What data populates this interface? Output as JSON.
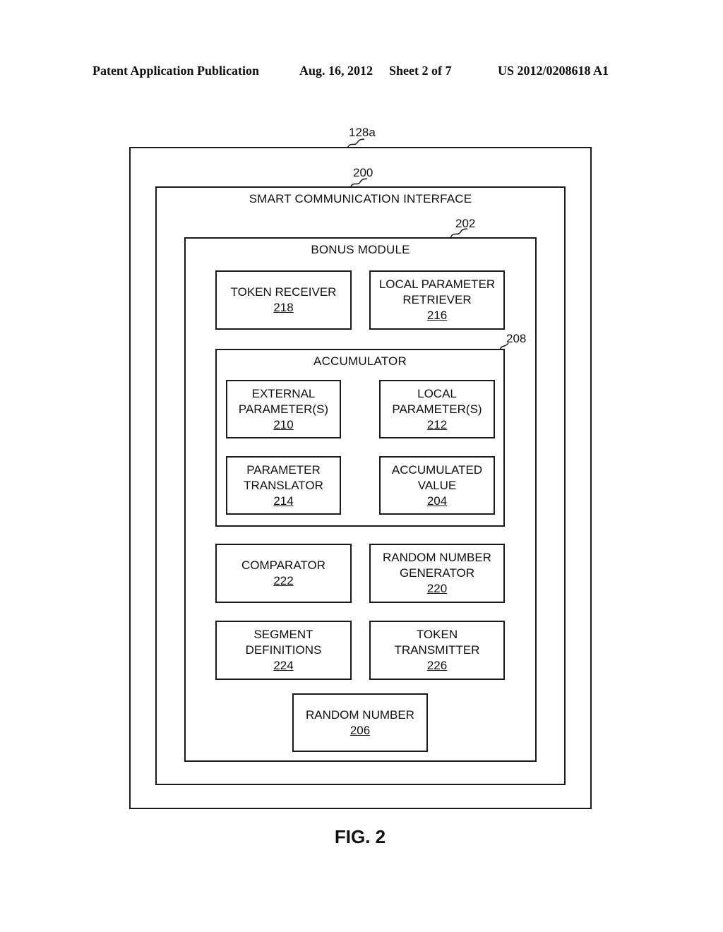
{
  "header": {
    "publication": "Patent Application Publication",
    "date": "Aug. 16, 2012",
    "sheet": "Sheet 2 of 7",
    "number": "US 2012/0208618 A1"
  },
  "containers": {
    "outer": {
      "ref": "128a"
    },
    "interface": {
      "ref": "200",
      "title": "SMART COMMUNICATION INTERFACE"
    },
    "bonus_module": {
      "ref": "202",
      "title": "BONUS MODULE"
    },
    "accumulator": {
      "ref": "208",
      "title": "ACCUMULATOR"
    }
  },
  "modules": {
    "token_receiver": {
      "lines": [
        "TOKEN RECEIVER"
      ],
      "num": "218"
    },
    "local_param_retriever": {
      "lines": [
        "LOCAL PARAMETER",
        "RETRIEVER"
      ],
      "num": "216"
    },
    "external_params": {
      "lines": [
        "EXTERNAL",
        "PARAMETER(S)"
      ],
      "num": "210"
    },
    "local_params": {
      "lines": [
        "LOCAL",
        "PARAMETER(S)"
      ],
      "num": "212"
    },
    "param_translator": {
      "lines": [
        "PARAMETER",
        "TRANSLATOR"
      ],
      "num": "214"
    },
    "accumulated_value": {
      "lines": [
        "ACCUMULATED",
        "VALUE"
      ],
      "num": "204"
    },
    "comparator": {
      "lines": [
        "COMPARATOR"
      ],
      "num": "222"
    },
    "rng": {
      "lines": [
        "RANDOM NUMBER",
        "GENERATOR"
      ],
      "num": "220"
    },
    "segment_defs": {
      "lines": [
        "SEGMENT",
        "DEFINITIONS"
      ],
      "num": "224"
    },
    "token_transmitter": {
      "lines": [
        "TOKEN",
        "TRANSMITTER"
      ],
      "num": "226"
    },
    "random_number": {
      "lines": [
        "RANDOM NUMBER"
      ],
      "num": "206"
    }
  },
  "figure_label": "FIG. 2"
}
